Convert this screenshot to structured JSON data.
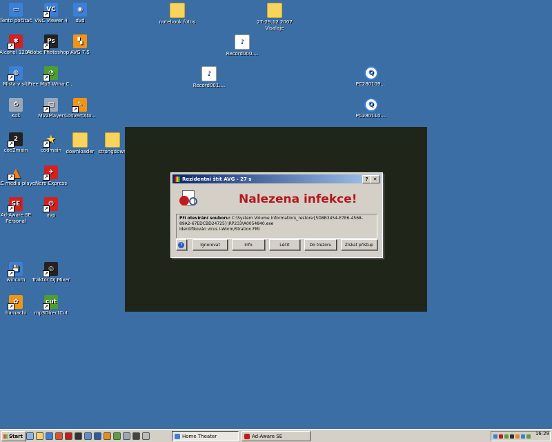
{
  "desktop": {
    "icons": [
      {
        "label": "Tento počítač",
        "icon": "computer-icon",
        "glyph": "▭",
        "color": "blue"
      },
      {
        "label": "VNC Viewer 4",
        "icon": "vnc-viewer-icon",
        "glyph": "VC",
        "color": "blue"
      },
      {
        "label": "dvd",
        "icon": "dvd-icon",
        "glyph": "◉",
        "color": "blue"
      },
      {
        "label": "notebook fotos",
        "icon": "folder-icon",
        "glyph": "",
        "color": "folder"
      },
      {
        "label": "27-29.12 2007 Visalaje",
        "icon": "folder-icon",
        "glyph": "",
        "color": "folder"
      },
      {
        "label": "Alcohol 120%",
        "icon": "alcohol-icon",
        "glyph": "✱",
        "color": "red"
      },
      {
        "label": "Adobe Photoshop ...",
        "icon": "photoshop-icon",
        "glyph": "Ps",
        "color": "dark"
      },
      {
        "label": "AVG 7.5",
        "icon": "avg-icon",
        "glyph": "▚",
        "color": "orange"
      },
      {
        "label": "Record000....",
        "icon": "sound-file-icon",
        "glyph": "♪",
        "color": "doc"
      },
      {
        "label": "Místa v síti",
        "icon": "network-places-icon",
        "glyph": "◍",
        "color": "blue"
      },
      {
        "label": "Free Mp3 Wma C...",
        "icon": "mp3-converter-icon",
        "glyph": "◔",
        "color": "green"
      },
      {
        "label": "Record001....",
        "icon": "sound-file-icon",
        "glyph": "♪",
        "color": "doc"
      },
      {
        "label": "PC280109....",
        "icon": "quicktime-icon",
        "glyph": "Q",
        "color": "cyan"
      },
      {
        "label": "Koš",
        "icon": "recycle-bin-icon",
        "glyph": "♻",
        "color": "gray"
      },
      {
        "label": "MV2Player",
        "icon": "mv2player-icon",
        "glyph": "▤",
        "color": "gray"
      },
      {
        "label": "ConvertXto...",
        "icon": "convertx-icon",
        "glyph": "✎",
        "color": "orange"
      },
      {
        "label": "PC280110....",
        "icon": "quicktime-icon",
        "glyph": "Q",
        "color": "cyan"
      },
      {
        "label": "cod2main",
        "icon": "cod2-icon",
        "glyph": "2",
        "color": "dark"
      },
      {
        "label": "codmain",
        "icon": "cod-icon",
        "glyph": "★",
        "color": "star"
      },
      {
        "label": "downloader",
        "icon": "folder-icon",
        "glyph": "",
        "color": "folder"
      },
      {
        "label": "strongdown",
        "icon": "folder-icon",
        "glyph": "",
        "color": "folder"
      },
      {
        "label": "VLC media player",
        "icon": "vlc-icon",
        "glyph": "▲",
        "color": "cone"
      },
      {
        "label": "Nero Express",
        "icon": "nero-icon",
        "glyph": "✈",
        "color": "red"
      },
      {
        "label": "Ad-Aware SE Personal",
        "icon": "adaware-icon",
        "glyph": "SE",
        "color": "red"
      },
      {
        "label": "avp",
        "icon": "avp-icon",
        "glyph": "⏻",
        "color": "red"
      },
      {
        "label": "wincom",
        "icon": "wincom-icon",
        "glyph": "💾",
        "color": "blue"
      },
      {
        "label": "Traktor DJ Mixer",
        "icon": "traktor-icon",
        "glyph": "◎",
        "color": "dark"
      },
      {
        "label": "hamachi",
        "icon": "hamachi-icon",
        "glyph": "✿",
        "color": "orange"
      },
      {
        "label": "mp3DirectCut",
        "icon": "mp3directcut-icon",
        "glyph": "cut",
        "color": "green"
      }
    ]
  },
  "dialog": {
    "title": "Rezidentní štít AVG - 27 s",
    "help_btn": "?",
    "close_btn": "✕",
    "heading": "Nalezena infekce!",
    "file_label": "Při otevírání souboru:",
    "file_path": "C:\\System Volume Information\\_restore{5D8B3454-E7E6-4568-89A2-67EDCBD24725}\\RP233\\A0054840.exe",
    "virus_text": "Identifikován virus I-Worm/Stration.FMI",
    "buttons": {
      "help": "?",
      "ignore": "Ignorovat",
      "info": "Info",
      "heal": "Léčit",
      "vault": "Do trezoru",
      "access": "Získat přístup"
    }
  },
  "taskbar": {
    "start": "Start",
    "tasks": [
      {
        "label": "Home Theater",
        "active": true
      },
      {
        "label": "Ad-Aware SE",
        "active": false
      }
    ],
    "clock": "16:29"
  }
}
